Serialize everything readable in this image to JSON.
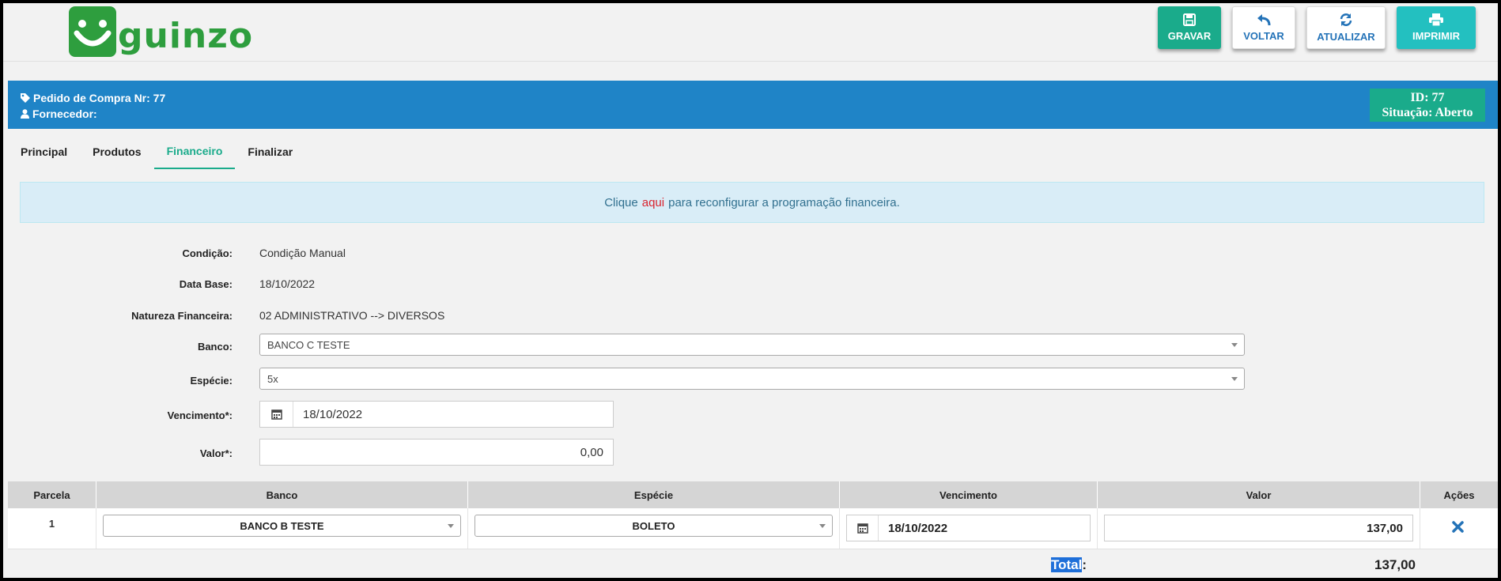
{
  "brand": {
    "logo_text": "guinzo",
    "color": "#2e9e3e"
  },
  "toolbar": {
    "save_label": "GRAVAR",
    "back_label": "VOLTAR",
    "refresh_label": "ATUALIZAR",
    "print_label": "IMPRIMIR"
  },
  "header": {
    "order_label": "Pedido de Compra Nr: 77",
    "supplier_label": "Fornecedor:",
    "id_text": "ID: 77",
    "status_text": "Situação: Aberto",
    "color": "#1f84c7"
  },
  "tabs": [
    {
      "label": "Principal",
      "active": false
    },
    {
      "label": "Produtos",
      "active": false
    },
    {
      "label": "Financeiro",
      "active": true
    },
    {
      "label": "Finalizar",
      "active": false
    }
  ],
  "alert": {
    "before": "Clique",
    "link": "aqui",
    "after": "para reconfigurar a programação financeira."
  },
  "form": {
    "condicao_label": "Condição:",
    "condicao_value": "Condição Manual",
    "data_base_label": "Data Base:",
    "data_base_value": "18/10/2022",
    "natureza_label": "Natureza Financeira:",
    "natureza_value": "02 ADMINISTRATIVO --> DIVERSOS",
    "banco_label": "Banco:",
    "banco_value": "BANCO C TESTE",
    "especie_label": "Espécie:",
    "especie_value": "5x",
    "vencimento_label": "Vencimento*:",
    "vencimento_value": "18/10/2022",
    "valor_label": "Valor*:",
    "valor_value": "0,00"
  },
  "table": {
    "columns": [
      "Parcela",
      "Banco",
      "Espécie",
      "Vencimento",
      "Valor",
      "Ações"
    ],
    "rows": [
      {
        "parcela": "1",
        "banco": "BANCO B TESTE",
        "especie": "BOLETO",
        "vencimento": "18/10/2022",
        "valor": "137,00"
      }
    ],
    "total_label": "Total",
    "total_colon": ":",
    "total_value": "137,00"
  }
}
